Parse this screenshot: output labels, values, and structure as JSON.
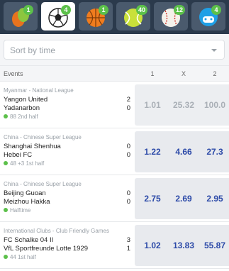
{
  "sports": [
    {
      "name": "soccer-veggie",
      "badge": "1",
      "active": false
    },
    {
      "name": "football",
      "badge": "4",
      "active": true
    },
    {
      "name": "basketball",
      "badge": "1",
      "active": false
    },
    {
      "name": "tennis",
      "badge": "40",
      "active": false
    },
    {
      "name": "baseball",
      "badge": "12",
      "active": false
    },
    {
      "name": "esports",
      "badge": "4",
      "active": false
    }
  ],
  "filter": {
    "sort_value": "Sort by time"
  },
  "header": {
    "events": "Events",
    "col1": "1",
    "colx": "X",
    "col2": "2"
  },
  "colors": {
    "topbar": "#2b3a4c",
    "badge": "#5cc04a",
    "odds_text": "#2c4aa8"
  },
  "matches": [
    {
      "league": "Myanmar - National League",
      "home": "Yangon United",
      "away": "Yadanarbon",
      "home_score": "2",
      "away_score": "0",
      "status": "88 2nd half",
      "odd1": "1.01",
      "oddx": "25.32",
      "odd2": "100.0",
      "locked": true
    },
    {
      "league": "China - Chinese Super League",
      "home": "Shanghai Shenhua",
      "away": "Hebei FC",
      "home_score": "0",
      "away_score": "0",
      "status": "48 +3  1st half",
      "odd1": "1.22",
      "oddx": "4.66",
      "odd2": "27.3",
      "locked": false
    },
    {
      "league": "China - Chinese Super League",
      "home": "Beijing Guoan",
      "away": "Meizhou Hakka",
      "home_score": "0",
      "away_score": "0",
      "status": "Halftime",
      "odd1": "2.75",
      "oddx": "2.69",
      "odd2": "2.95",
      "locked": false
    },
    {
      "league": "International Clubs - Club Friendly Games",
      "home": "FC Schalke 04 II",
      "away": "VfL Sportfreunde Lotte 1929",
      "home_score": "3",
      "away_score": "1",
      "status": "44 1st half",
      "odd1": "1.02",
      "oddx": "13.83",
      "odd2": "55.87",
      "locked": false
    }
  ]
}
